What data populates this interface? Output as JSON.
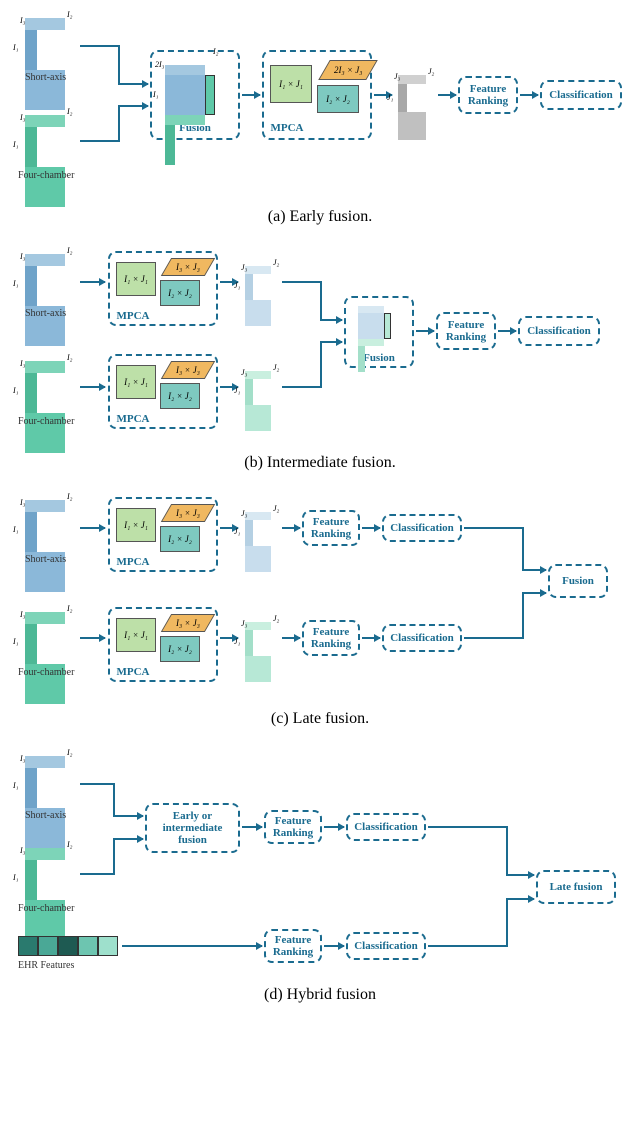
{
  "captions": {
    "a": "(a) Early fusion.",
    "b": "(b) Intermediate fusion.",
    "c": "(c) Late fusion.",
    "d": "(d) Hybrid fusion"
  },
  "labels": {
    "short_axis": "Short-axis",
    "four_chamber": "Four-chamber",
    "ehr": "EHR Features",
    "fusion": "Fusion",
    "mpca": "MPCA",
    "feature_ranking": "Feature\nRanking",
    "classification": "Classification",
    "late_fusion": "Late fusion",
    "early_or_intermediate": "Early or\nintermediate\nfusion"
  },
  "dims": {
    "I1": "I₁",
    "I2": "I₂",
    "I3": "I₃",
    "J1": "J₁",
    "J2": "J₂",
    "J3": "J₃",
    "twoI3": "2I₃"
  },
  "proj": {
    "p1": "I₁ × J₁",
    "p2": "I₂ × J₂",
    "p3": "I₃ × J₃",
    "p3b": "2I₃ × J₃"
  }
}
